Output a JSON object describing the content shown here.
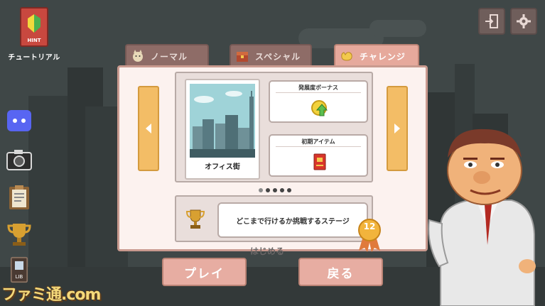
{
  "tabs": [
    {
      "label": "ノーマル",
      "icon": "cat-icon",
      "active": false
    },
    {
      "label": "スペシャル",
      "icon": "treasure-chest-icon",
      "active": false
    },
    {
      "label": "チャレンジ",
      "icon": "muscle-icon",
      "active": true
    }
  ],
  "sidebar": {
    "tutorial_label": "チュートリアル",
    "tutorial_book_text": "HINT",
    "items": [
      "discord-icon",
      "camera-icon",
      "clipboard-icon",
      "trophy-icon",
      "library-icon"
    ],
    "library_text": "LIB"
  },
  "top_right": [
    "exit-icon",
    "gear-icon"
  ],
  "stage": {
    "name": "オフィス街",
    "bonus_title": "発展度ボーナス",
    "bonus_icon": "coin-up-icon",
    "item_title": "初期アイテム",
    "item_icon": "red-book-icon",
    "page_count": 5,
    "current_page": 1
  },
  "goal": {
    "description": "どこまで行けるか挑戦するステージ",
    "medal_value": "12"
  },
  "buttons": {
    "play": "プレイ",
    "back": "戻る"
  },
  "ghost_text": "はじめる",
  "watermark": "ファミ通.com",
  "colors": {
    "panel": "#fcf2ef",
    "accent": "#e7ada2",
    "arrow": "#f3bd66",
    "background": "#3f4747"
  }
}
